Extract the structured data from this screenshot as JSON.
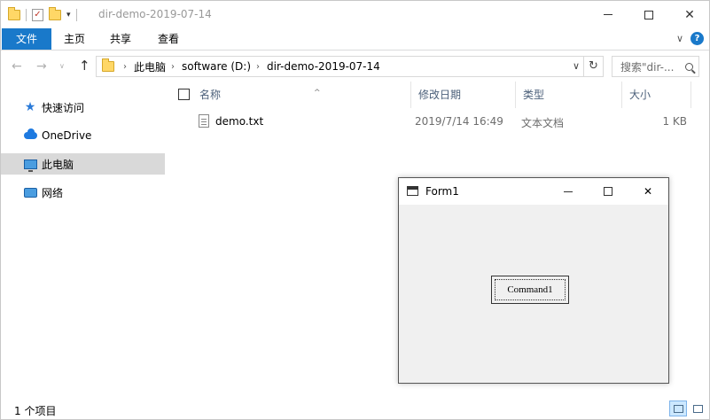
{
  "window": {
    "title": "dir-demo-2019-07-14"
  },
  "ribbon": {
    "tabs": [
      "文件",
      "主页",
      "共享",
      "查看"
    ]
  },
  "address": {
    "crumbs": [
      "此电脑",
      "software (D:)",
      "dir-demo-2019-07-14"
    ],
    "search_placeholder": "搜索\"dir-..."
  },
  "nav": {
    "items": [
      {
        "label": "快速访问",
        "icon": "star-icon"
      },
      {
        "label": "OneDrive",
        "icon": "cloud-icon"
      },
      {
        "label": "此电脑",
        "icon": "computer-icon",
        "selected": true
      },
      {
        "label": "网络",
        "icon": "network-icon"
      }
    ]
  },
  "filelist": {
    "columns": [
      "名称",
      "修改日期",
      "类型",
      "大小"
    ],
    "rows": [
      {
        "name": "demo.txt",
        "date": "2019/7/14 16:49",
        "type": "文本文档",
        "size": "1 KB"
      }
    ]
  },
  "status": {
    "text": "1 个项目"
  },
  "form1": {
    "title": "Form1",
    "button_label": "Command1"
  },
  "colors": {
    "accent": "#1979ca",
    "selection": "#d9d9d9",
    "dialog_bg": "#f0f0f0"
  }
}
